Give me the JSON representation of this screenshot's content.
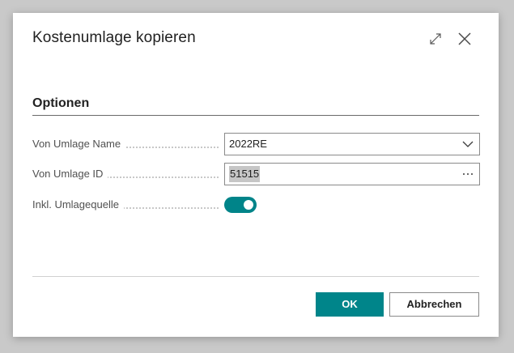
{
  "dialog": {
    "title": "Kostenumlage kopieren",
    "expand_icon": "expand-icon",
    "close_icon": "close-icon"
  },
  "section": {
    "title": "Optionen"
  },
  "fields": {
    "von_umlage_name": {
      "label": "Von Umlage Name",
      "value": "2022RE",
      "control": "dropdown",
      "icon": "chevron-down-icon"
    },
    "von_umlage_id": {
      "label": "Von Umlage ID",
      "value": "51515",
      "control": "lookup",
      "icon": "ellipsis-icon",
      "text_selected": true
    },
    "inkl_umlagequelle": {
      "label": "Inkl. Umlagequelle",
      "value": true,
      "control": "toggle"
    }
  },
  "buttons": {
    "ok_label": "OK",
    "cancel_label": "Abbrechen"
  },
  "colors": {
    "accent": "#00858a",
    "background": "#c9c9c9",
    "dialog": "#ffffff"
  }
}
